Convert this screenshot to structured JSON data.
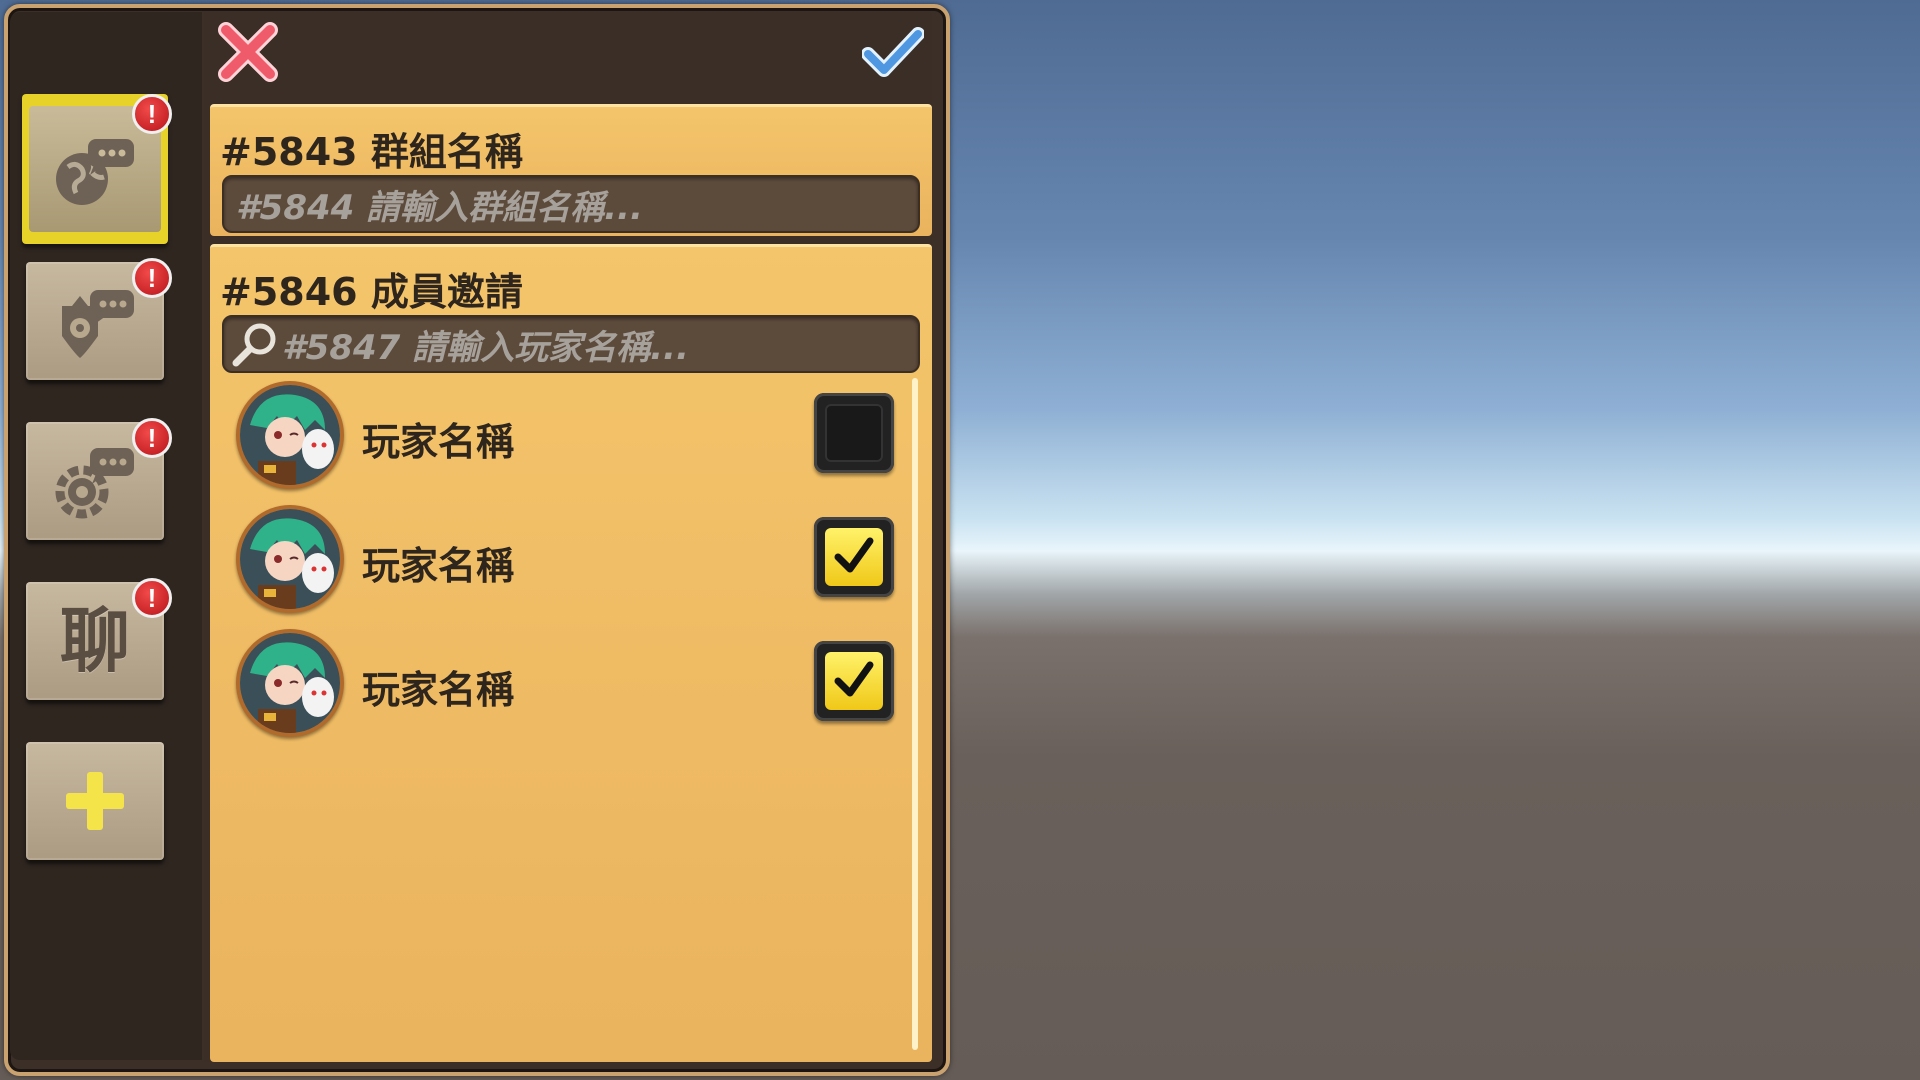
{
  "sidebar": {
    "tabs": [
      {
        "name": "world-chat-tab",
        "icon": "globe-chat-icon",
        "badge": "!",
        "selected": true
      },
      {
        "name": "guild-chat-tab",
        "icon": "guild-emblem-chat-icon",
        "badge": "!",
        "selected": false
      },
      {
        "name": "system-chat-tab",
        "icon": "gear-chat-icon",
        "badge": "!",
        "selected": false
      },
      {
        "name": "private-chat-tab",
        "char": "聊",
        "badge": "!",
        "selected": false
      },
      {
        "name": "add-group-tab",
        "icon": "plus-icon",
        "selected": false
      }
    ]
  },
  "toolbar": {
    "close_icon": "close-x-icon",
    "confirm_icon": "checkmark-icon"
  },
  "group_name": {
    "title": "#5843 群組名稱",
    "placeholder": "#5844 請輸入群組名稱..."
  },
  "invite": {
    "title": "#5846 成員邀請",
    "search_placeholder": "#5847 請輸入玩家名稱...",
    "players": [
      {
        "name": "玩家名稱",
        "checked": false
      },
      {
        "name": "玩家名稱",
        "checked": true
      },
      {
        "name": "玩家名稱",
        "checked": true
      }
    ]
  },
  "colors": {
    "section_bg": "#f4c56b",
    "selected_tab": "#e7d22a",
    "badge": "#d81e24",
    "check_fill": "#f7e02e"
  }
}
